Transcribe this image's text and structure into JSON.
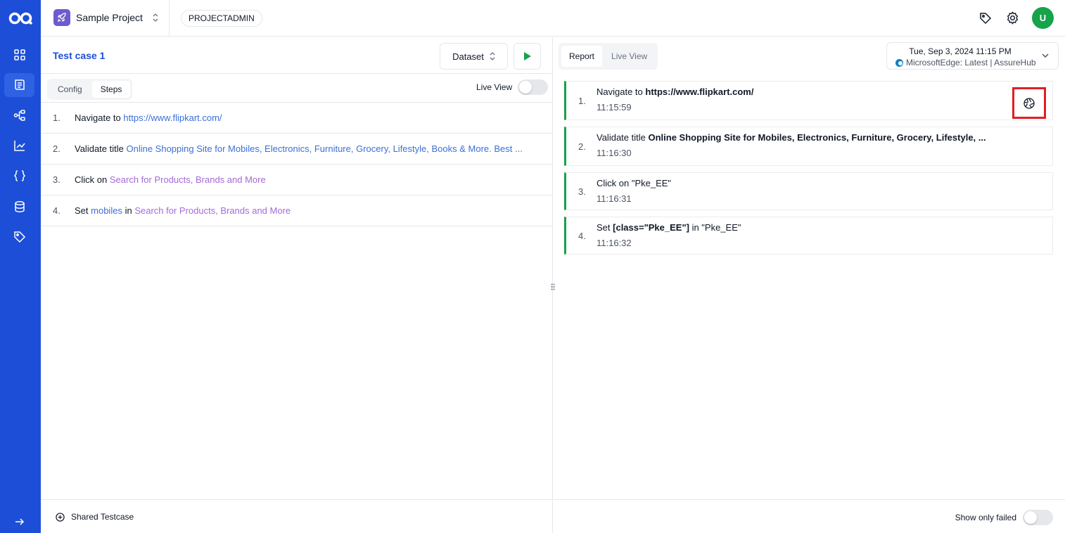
{
  "project": {
    "name": "Sample Project",
    "role": "PROJECTADMIN",
    "avatar_initial": "U"
  },
  "colors": {
    "rail": "#1d4ed8",
    "accent": "#1d4ed8",
    "success": "#16a34a",
    "highlight_box": "#e11d24",
    "link": "#3b6fd8",
    "element": "#a46ad8",
    "avatar": "#16a34a"
  },
  "rail": {
    "items": [
      {
        "icon": "dashboard-grid-icon",
        "active": false
      },
      {
        "icon": "test-cases-list-icon",
        "active": true
      },
      {
        "icon": "workflow-icon",
        "active": false
      },
      {
        "icon": "reports-chart-icon",
        "active": false
      },
      {
        "icon": "variables-braces-icon",
        "active": false
      },
      {
        "icon": "database-icon",
        "active": false
      },
      {
        "icon": "tag-icon",
        "active": false
      }
    ]
  },
  "testcase": {
    "title": "Test case 1",
    "dataset_label": "Dataset",
    "tabs": [
      "Config",
      "Steps"
    ],
    "selected_tab": "Steps",
    "live_view_label": "Live View",
    "live_view_on": false,
    "steps": [
      {
        "num": "1.",
        "action": "Navigate to",
        "link": "https://www.flipkart.com/"
      },
      {
        "num": "2.",
        "action": "Validate title",
        "link": "Online Shopping Site for Mobiles, Electronics, Furniture, Grocery, Lifestyle, Books & More. Best ..."
      },
      {
        "num": "3.",
        "action": "Click on",
        "element": "Search for Products, Brands and More"
      },
      {
        "num": "4.",
        "action": "Set",
        "value": "mobiles",
        "connector": "in",
        "element": "Search for Products, Brands and More"
      }
    ],
    "shared_label": "Shared Testcase"
  },
  "report": {
    "tabs": [
      "Report",
      "Live View"
    ],
    "selected_tab": "Report",
    "run": {
      "date": "Tue, Sep 3, 2024 11:15 PM",
      "env": "MicrosoftEdge: Latest | AssureHub"
    },
    "results": [
      {
        "num": "1.",
        "action": "Navigate to",
        "target": "https://www.flipkart.com/",
        "time": "11:15:59",
        "status": "passed"
      },
      {
        "num": "2.",
        "action": "Validate title",
        "target": "Online Shopping Site for Mobiles, Electronics, Furniture, Grocery, Lifestyle, ...",
        "time": "11:16:30",
        "status": "passed"
      },
      {
        "num": "3.",
        "action": "Click on \"Pke_EE\"",
        "time": "11:16:31",
        "status": "passed"
      },
      {
        "num": "4.",
        "action": "Set",
        "target": "[class=\"Pke_EE\"]",
        "suffix": "in \"Pke_EE\"",
        "time": "11:16:32",
        "status": "passed"
      }
    ],
    "only_failed_label": "Show only failed",
    "only_failed_on": false
  }
}
